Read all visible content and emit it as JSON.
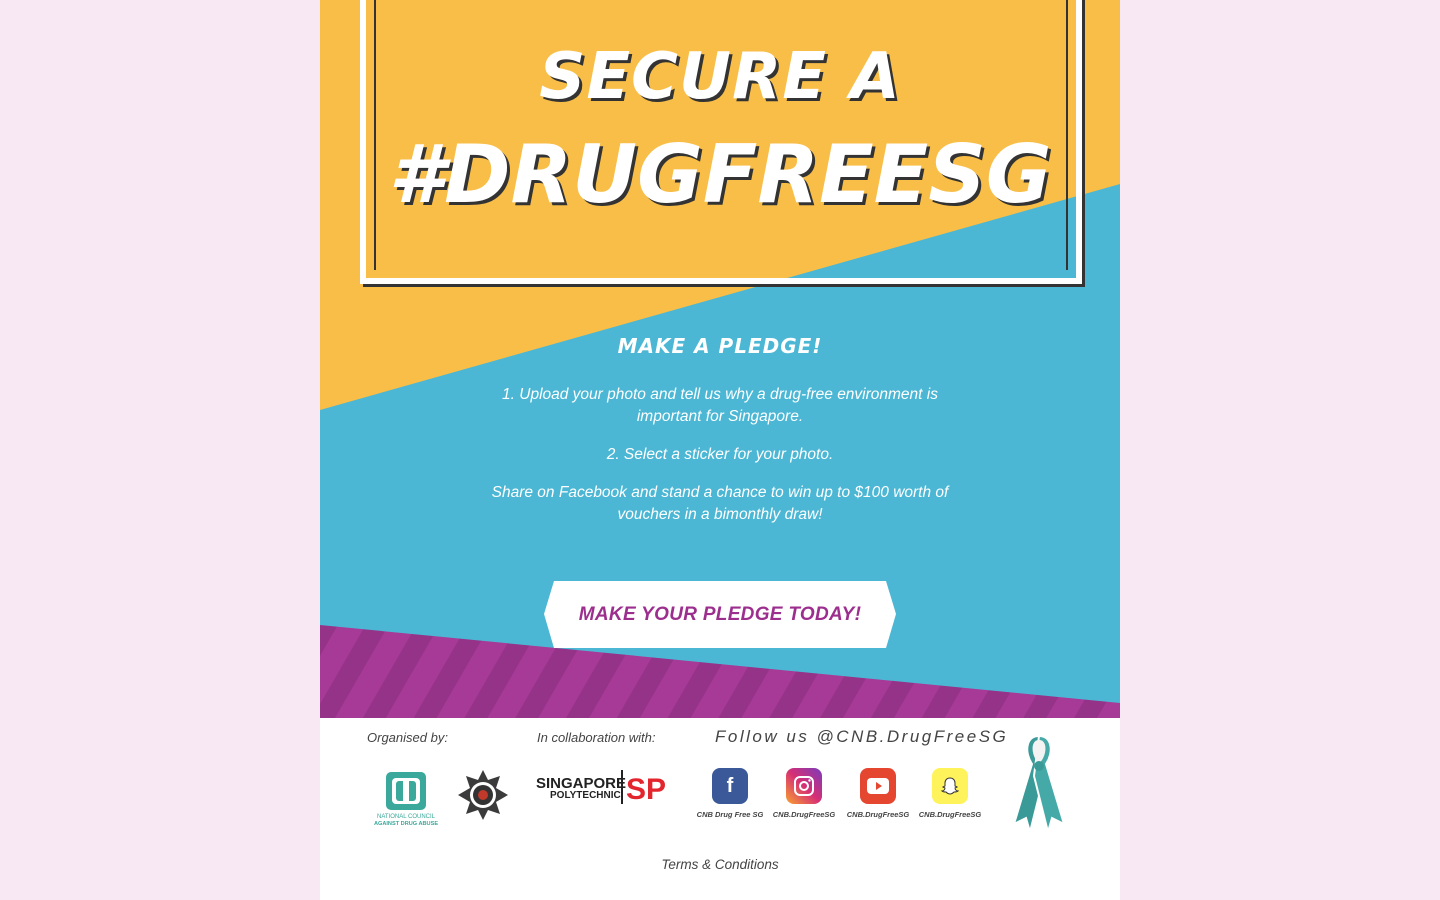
{
  "hero": {
    "title_top": "SECURE A",
    "title_main": "#DRUGFREESG",
    "colors": {
      "yellow": "#f8be48",
      "blue": "#4bb7d4",
      "purple": "#a73a96",
      "purple_stripe": "#953389"
    }
  },
  "pledge": {
    "heading": "MAKE A PLEDGE!",
    "step1": "1. Upload your photo and tell us why a drug-free environment is important for Singapore.",
    "step2": "2. Select a sticker for your photo.",
    "share": "Share on Facebook and stand a chance to win up to $100 worth of vouchers in a bimonthly draw!",
    "cta_label": "MAKE YOUR PLEDGE TODAY!"
  },
  "footer": {
    "organised_label": "Organised by:",
    "collab_label": "In collaboration with:",
    "follow_label": "Follow us @CNB.DrugFreeSG",
    "ncada_text_1": "NATIONAL COUNCIL",
    "ncada_text_2": "AGAINST DRUG ABUSE",
    "sp_text_1": "SINGAPORE",
    "sp_text_2": "POLYTECHNIC",
    "sp_mark": "SP",
    "social": [
      {
        "name": "facebook",
        "icon": "facebook-icon",
        "caption": "CNB Drug Free SG",
        "color": "#3b5998"
      },
      {
        "name": "instagram",
        "icon": "instagram-icon",
        "caption": "CNB.DrugFreeSG",
        "color": "#c13584"
      },
      {
        "name": "youtube",
        "icon": "youtube-icon",
        "caption": "CNB.DrugFreeSG",
        "color": "#e5462f"
      },
      {
        "name": "snapchat",
        "icon": "snapchat-icon",
        "caption": "CNB.DrugFreeSG",
        "color": "#fff35c"
      }
    ],
    "terms_label": "Terms & Conditions"
  }
}
